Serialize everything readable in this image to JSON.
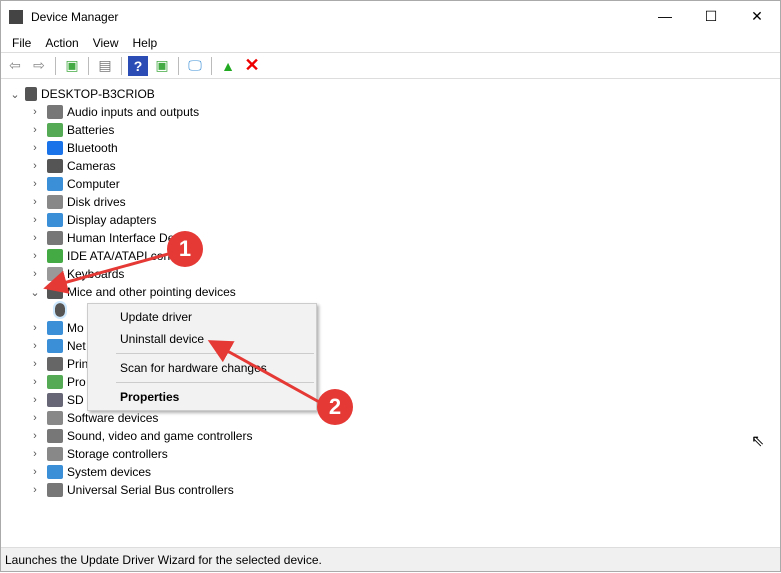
{
  "window": {
    "title": "Device Manager",
    "minimize": "—",
    "maximize": "☐",
    "close": "✕"
  },
  "menubar": [
    "File",
    "Action",
    "View",
    "Help"
  ],
  "tree": {
    "root": "DESKTOP-B3CRIOB",
    "items": [
      {
        "label": "Audio inputs and outputs",
        "color": "#777"
      },
      {
        "label": "Batteries",
        "color": "#5a5"
      },
      {
        "label": "Bluetooth",
        "color": "#1a73e8"
      },
      {
        "label": "Cameras",
        "color": "#555"
      },
      {
        "label": "Computer",
        "color": "#3b8fd6"
      },
      {
        "label": "Disk drives",
        "color": "#888"
      },
      {
        "label": "Display adapters",
        "color": "#3b8fd6"
      },
      {
        "label": "Human Interface De",
        "color": "#777"
      },
      {
        "label": "IDE ATA/ATAPI contr",
        "color": "#4a4"
      },
      {
        "label": "Keyboards",
        "color": "#999"
      },
      {
        "label": "Mice and other pointing devices",
        "color": "#555",
        "expanded": true
      },
      {
        "label": "",
        "color": "#555",
        "child": true,
        "selected": true
      },
      {
        "label": "Mo",
        "color": "#3b8fd6"
      },
      {
        "label": "Net",
        "color": "#3b8fd6"
      },
      {
        "label": "Prin",
        "color": "#666"
      },
      {
        "label": "Pro",
        "color": "#5a5"
      },
      {
        "label": "SD I",
        "color": "#667"
      },
      {
        "label": "Software devices",
        "color": "#888"
      },
      {
        "label": "Sound, video and game controllers",
        "color": "#777"
      },
      {
        "label": "Storage controllers",
        "color": "#888"
      },
      {
        "label": "System devices",
        "color": "#3b8fd6"
      },
      {
        "label": "Universal Serial Bus controllers",
        "color": "#777"
      }
    ]
  },
  "context_menu": {
    "update": "Update driver",
    "uninstall": "Uninstall device",
    "scan": "Scan for hardware changes",
    "properties": "Properties"
  },
  "annotations": {
    "one": "1",
    "two": "2"
  },
  "status": "Launches the Update Driver Wizard for the selected device."
}
